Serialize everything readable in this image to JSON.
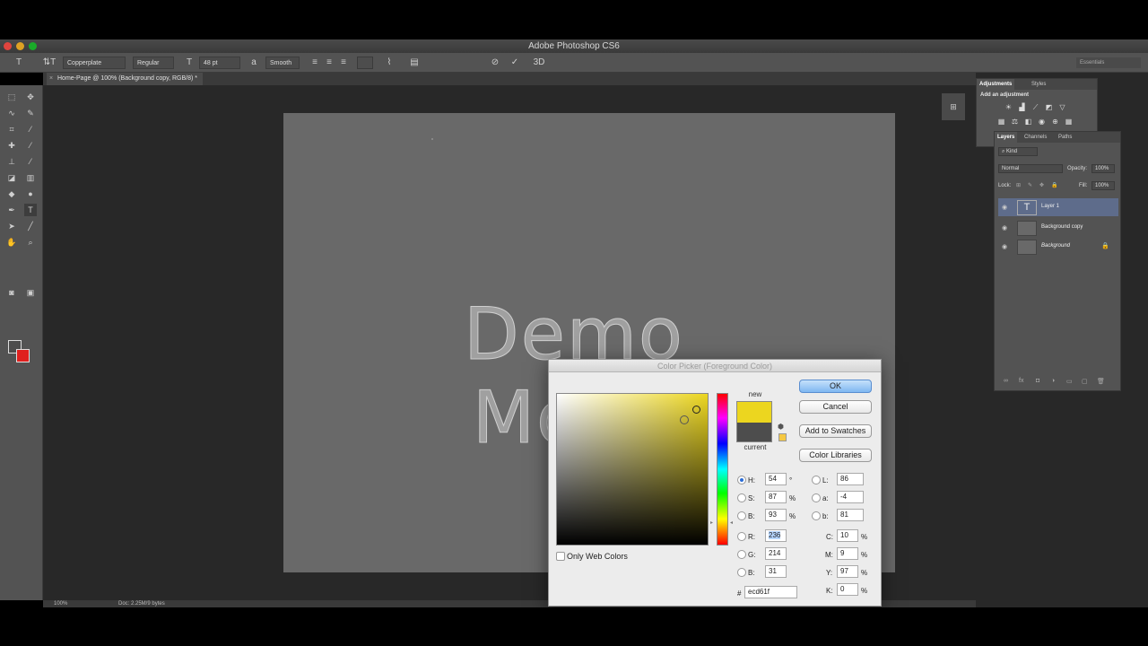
{
  "window": {
    "title": "Adobe Photoshop CS6"
  },
  "options_bar": {
    "tool_symbol": "T",
    "orientation_symbol": "⇅T",
    "font_family": "Copperplate",
    "font_style": "Regular",
    "font_size": "48 pt",
    "aa_label": "a",
    "antialias": "Smooth",
    "cancel_symbol": "⊘",
    "commit_symbol": "✓",
    "threed_label": "3D",
    "workspace": "Essentials"
  },
  "document": {
    "tab_title": "Home-Page @ 100% (Background copy, RGB/8) *",
    "canvas_text": "Demo Mode"
  },
  "status": {
    "zoom": "100%",
    "doc_size": "Doc: 2.25M/9 bytes"
  },
  "adjustments_panel": {
    "tabs": [
      "Adjustments",
      "Styles"
    ],
    "heading": "Add an adjustment"
  },
  "layers_panel": {
    "tabs": [
      "Layers",
      "Channels",
      "Paths"
    ],
    "kind_filter": "Kind",
    "blend_mode": "Normal",
    "opacity_label": "Opacity:",
    "opacity": "100%",
    "lock_label": "Lock:",
    "fill_label": "Fill:",
    "fill": "100%",
    "layers": [
      {
        "name": "Layer 1",
        "type": "text",
        "selected": true
      },
      {
        "name": "Background copy",
        "type": "pixel",
        "selected": false
      },
      {
        "name": "Background",
        "type": "pixel",
        "selected": false,
        "locked": true
      }
    ]
  },
  "color_picker": {
    "title": "Color Picker (Foreground Color)",
    "new_label": "new",
    "current_label": "current",
    "new_color": "#ecd61f",
    "current_color": "#4d4d4d",
    "buttons": {
      "ok": "OK",
      "cancel": "Cancel",
      "add_to_swatches": "Add to Swatches",
      "color_libraries": "Color Libraries"
    },
    "only_web_colors": "Only Web Colors",
    "hsb": {
      "h": {
        "label": "H:",
        "value": "54",
        "unit": "°"
      },
      "s": {
        "label": "S:",
        "value": "87",
        "unit": "%"
      },
      "b": {
        "label": "B:",
        "value": "93",
        "unit": "%"
      }
    },
    "rgb": {
      "r": {
        "label": "R:",
        "value": "236"
      },
      "g": {
        "label": "G:",
        "value": "214"
      },
      "b": {
        "label": "B:",
        "value": "31"
      }
    },
    "lab": {
      "l": {
        "label": "L:",
        "value": "86"
      },
      "a": {
        "label": "a:",
        "value": "-4"
      },
      "b": {
        "label": "b:",
        "value": "81"
      }
    },
    "cmyk": {
      "c": {
        "label": "C:",
        "value": "10",
        "unit": "%"
      },
      "m": {
        "label": "M:",
        "value": "9",
        "unit": "%"
      },
      "y": {
        "label": "Y:",
        "value": "97",
        "unit": "%"
      },
      "k": {
        "label": "K:",
        "value": "0",
        "unit": "%"
      }
    },
    "hex_label": "#",
    "hex": "ecd61f"
  },
  "colors": {
    "foreground": "#4d4d4d",
    "background": "#e0201e"
  }
}
